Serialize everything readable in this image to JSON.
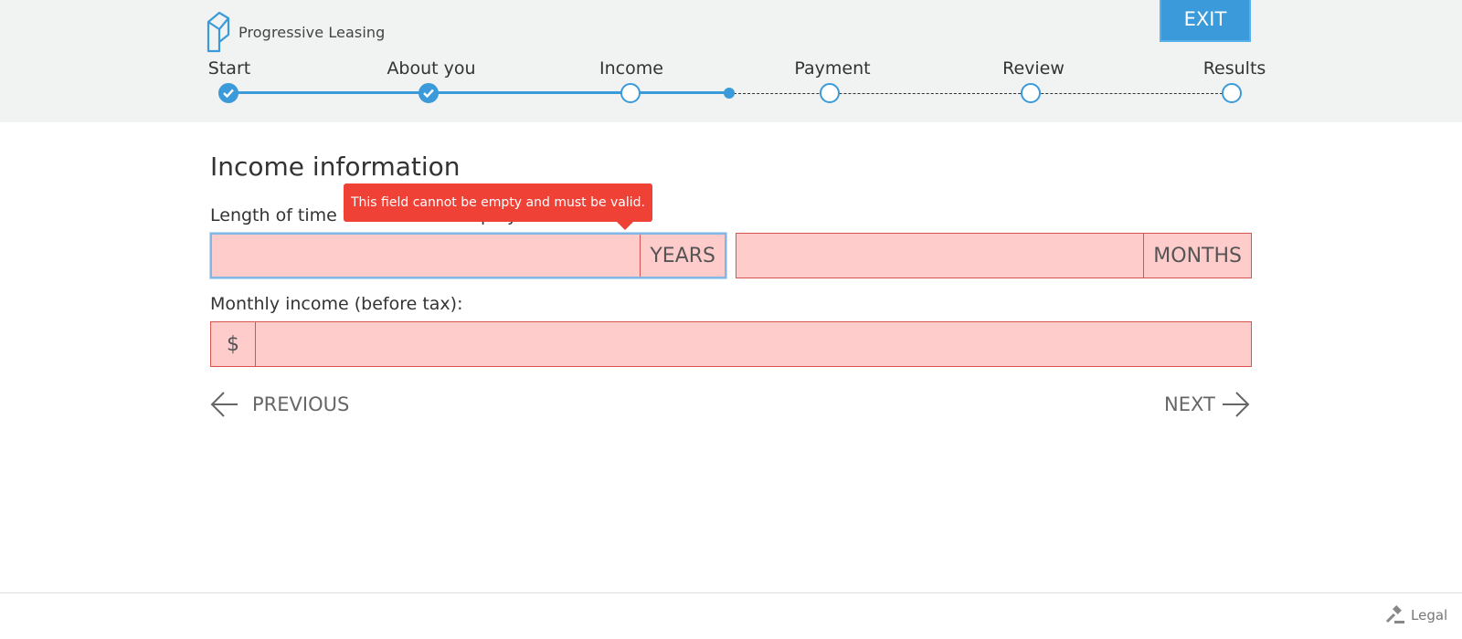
{
  "brand": {
    "name": "Progressive Leasing",
    "accent_color": "#3b9ad9",
    "error_color": "#ef4136",
    "error_field_bg": "#ffcccc"
  },
  "header": {
    "exit_label": "EXIT"
  },
  "stepper": {
    "steps": [
      {
        "label": "Start",
        "status": "complete"
      },
      {
        "label": "About you",
        "status": "complete"
      },
      {
        "label": "Income",
        "status": "current"
      },
      {
        "label": "Payment",
        "status": "upcoming"
      },
      {
        "label": "Review",
        "status": "upcoming"
      },
      {
        "label": "Results",
        "status": "upcoming"
      }
    ]
  },
  "form": {
    "title": "Income information",
    "employment_length": {
      "label": "Length of time with current employer:",
      "years_value": "",
      "years_unit": "YEARS",
      "months_value": "",
      "months_unit": "MONTHS"
    },
    "monthly_income": {
      "label": "Monthly income (before tax):",
      "currency_symbol": "$",
      "value": ""
    },
    "error_tooltip": "This field cannot be empty and must be valid."
  },
  "navigation": {
    "previous_label": "PREVIOUS",
    "next_label": "NEXT"
  },
  "footer": {
    "legal_label": "Legal"
  }
}
